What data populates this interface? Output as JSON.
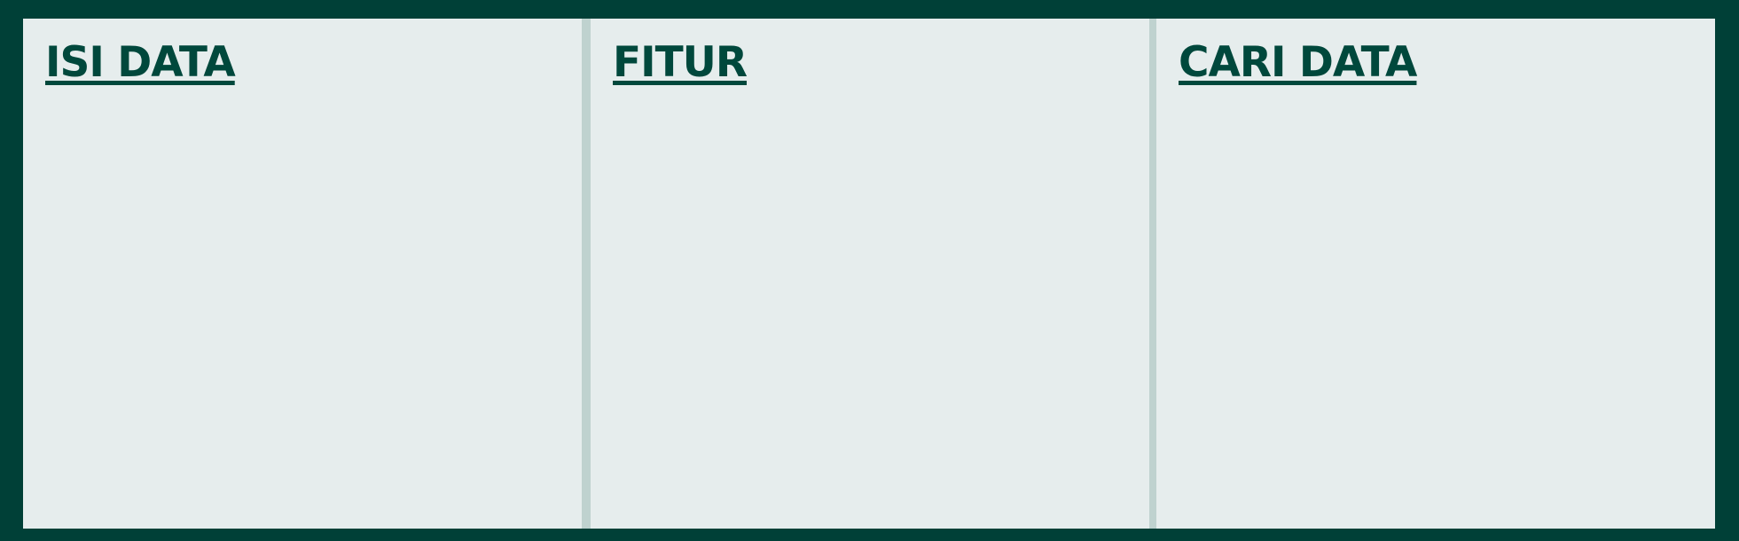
{
  "panels": [
    {
      "title": "ISI DATA"
    },
    {
      "title": "FITUR"
    },
    {
      "title": "CARI DATA"
    }
  ],
  "colors": {
    "frame": "#004037",
    "panel_bg": "#e6eded",
    "divider": "#bfd2cf",
    "title": "#00483c"
  }
}
